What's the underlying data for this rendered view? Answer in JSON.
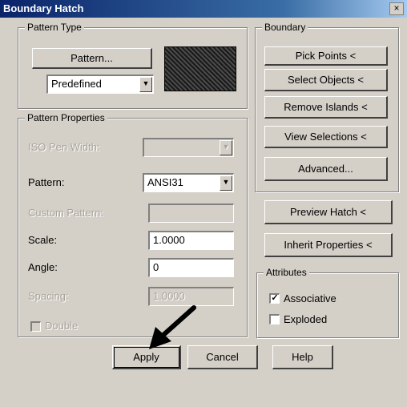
{
  "window": {
    "title": "Boundary Hatch",
    "close_glyph": "×"
  },
  "pattern_type": {
    "legend": "Pattern Type",
    "pattern_button": "Pattern...",
    "type_value": "Predefined",
    "swatch_icon": "hatch-pattern-ansi31"
  },
  "pattern_properties": {
    "legend": "Pattern Properties",
    "iso_pen_width_label": "ISO Pen Width:",
    "pattern_label": "Pattern:",
    "pattern_value": "ANSI31",
    "custom_pattern_label": "Custom Pattern:",
    "scale_label": "Scale:",
    "scale_value": "1.0000",
    "angle_label": "Angle:",
    "angle_value": "0",
    "spacing_label": "Spacing:",
    "spacing_value": "1.0000",
    "double_label": "Double"
  },
  "boundary": {
    "legend": "Boundary",
    "pick_points": "Pick Points <",
    "select_objects": "Select Objects <",
    "remove_islands": "Remove Islands <",
    "view_selections": "View Selections <",
    "advanced": "Advanced..."
  },
  "preview_hatch": "Preview Hatch <",
  "inherit_properties": "Inherit Properties <",
  "attributes": {
    "legend": "Attributes",
    "associative_label": "Associative",
    "associative_checked": true,
    "exploded_label": "Exploded",
    "exploded_checked": false
  },
  "footer": {
    "apply": "Apply",
    "cancel": "Cancel",
    "help": "Help"
  },
  "annotation": {
    "pointer_icon": "arrow-pointer",
    "color": "#000000"
  }
}
